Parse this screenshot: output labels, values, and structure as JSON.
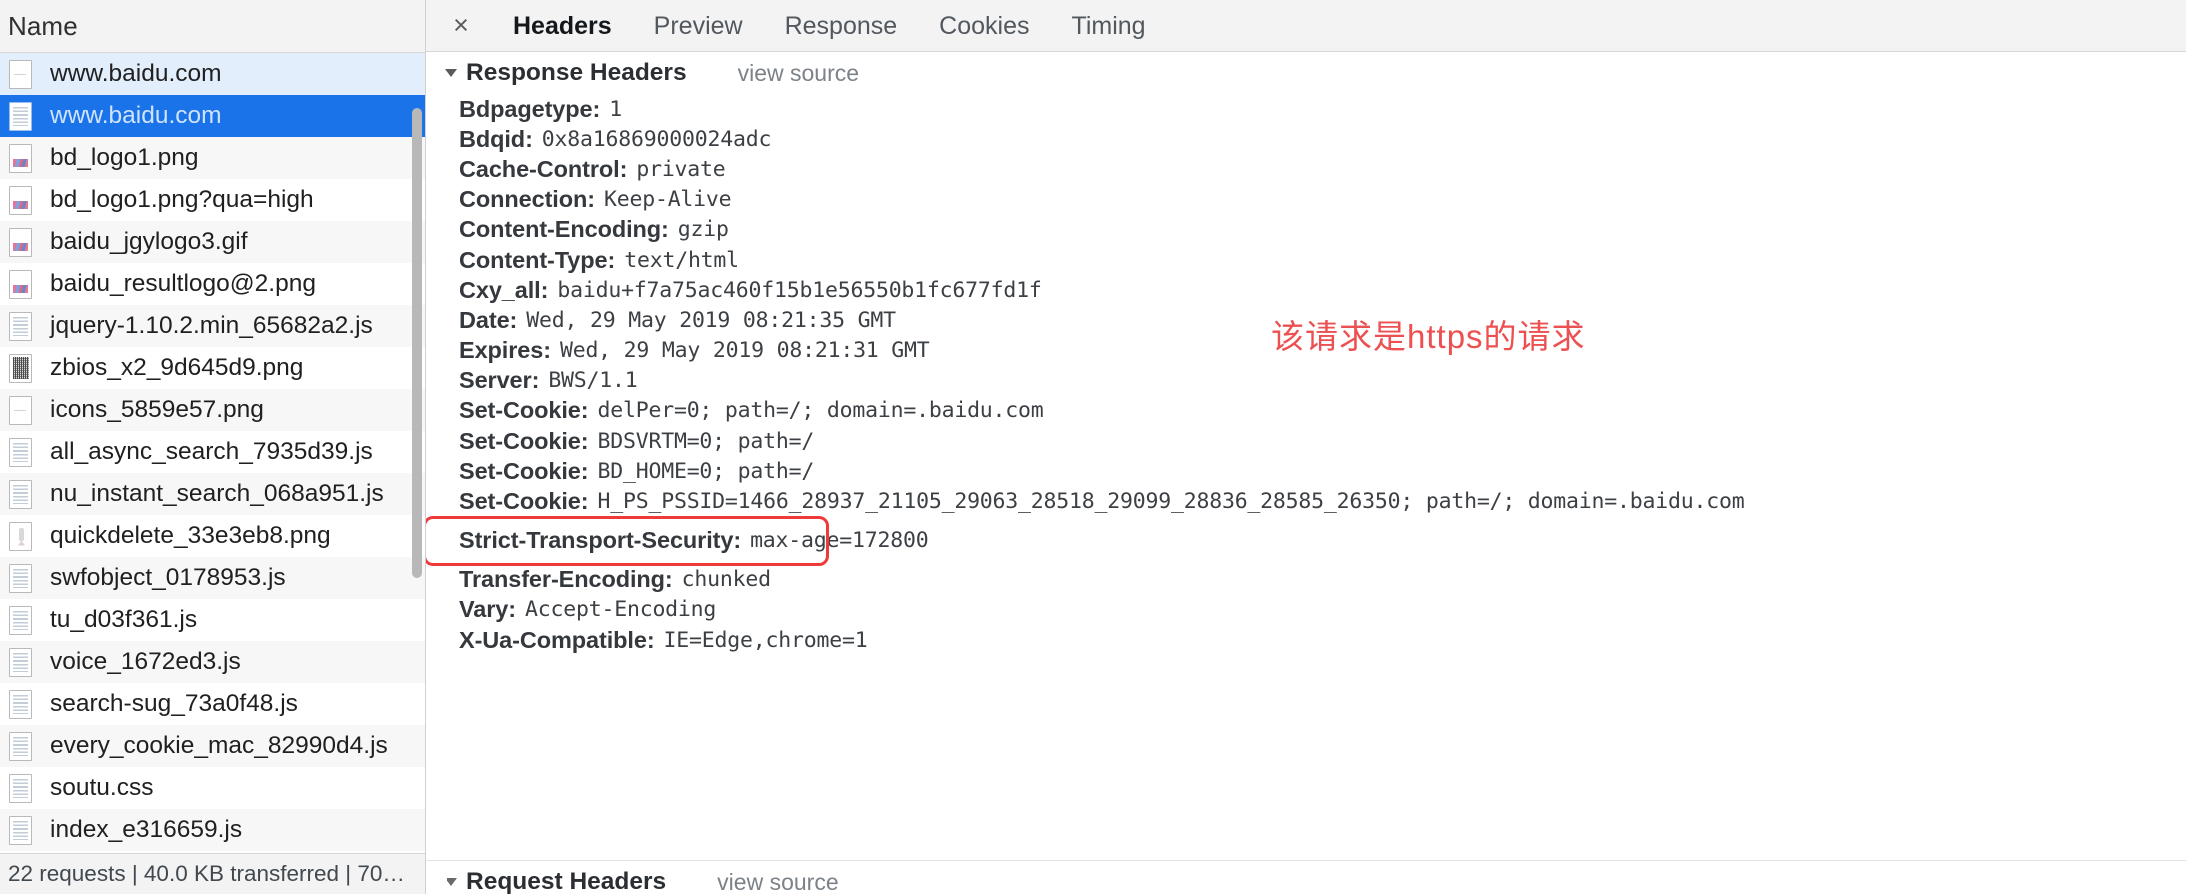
{
  "left_panel": {
    "column_header": "Name",
    "rows": [
      {
        "name": "www.baidu.com",
        "icon": "blank-document-icon",
        "state": "hovered"
      },
      {
        "name": "www.baidu.com",
        "icon": "document-icon",
        "state": "selected"
      },
      {
        "name": "bd_logo1.png",
        "icon": "image-file-icon",
        "state": "zebra"
      },
      {
        "name": "bd_logo1.png?qua=high",
        "icon": "image-file-icon",
        "state": "plain"
      },
      {
        "name": "baidu_jgylogo3.gif",
        "icon": "image-file-icon",
        "state": "zebra"
      },
      {
        "name": "baidu_resultlogo@2.png",
        "icon": "image-file-icon",
        "state": "plain"
      },
      {
        "name": "jquery-1.10.2.min_65682a2.js",
        "icon": "document-icon",
        "state": "zebra"
      },
      {
        "name": "zbios_x2_9d645d9.png",
        "icon": "qr-image-icon",
        "state": "plain"
      },
      {
        "name": "icons_5859e57.png",
        "icon": "blank-document-icon",
        "state": "zebra"
      },
      {
        "name": "all_async_search_7935d39.js",
        "icon": "document-icon",
        "state": "plain"
      },
      {
        "name": "nu_instant_search_068a951.js",
        "icon": "document-icon",
        "state": "zebra"
      },
      {
        "name": "quickdelete_33e3eb8.png",
        "icon": "marker-image-icon",
        "state": "plain"
      },
      {
        "name": "swfobject_0178953.js",
        "icon": "document-icon",
        "state": "zebra"
      },
      {
        "name": "tu_d03f361.js",
        "icon": "document-icon",
        "state": "plain"
      },
      {
        "name": "voice_1672ed3.js",
        "icon": "document-icon",
        "state": "zebra"
      },
      {
        "name": "search-sug_73a0f48.js",
        "icon": "document-icon",
        "state": "plain"
      },
      {
        "name": "every_cookie_mac_82990d4.js",
        "icon": "document-icon",
        "state": "zebra"
      },
      {
        "name": "soutu.css",
        "icon": "document-icon",
        "state": "plain"
      },
      {
        "name": "index_e316659.js",
        "icon": "document-icon",
        "state": "zebra"
      }
    ],
    "status_bar": "22 requests | 40.0 KB transferred | 70…"
  },
  "right_panel": {
    "close_label": "×",
    "tabs": [
      {
        "label": "Headers",
        "active": true
      },
      {
        "label": "Preview",
        "active": false
      },
      {
        "label": "Response",
        "active": false
      },
      {
        "label": "Cookies",
        "active": false
      },
      {
        "label": "Timing",
        "active": false
      }
    ],
    "response_section": {
      "title": "Response Headers",
      "view_source": "view source"
    },
    "request_section": {
      "title": "Request Headers",
      "view_source": "view source"
    },
    "headers": [
      {
        "name": "Bdpagetype:",
        "value": "1"
      },
      {
        "name": "Bdqid:",
        "value": "0x8a16869000024adc"
      },
      {
        "name": "Cache-Control:",
        "value": "private"
      },
      {
        "name": "Connection:",
        "value": "Keep-Alive"
      },
      {
        "name": "Content-Encoding:",
        "value": "gzip"
      },
      {
        "name": "Content-Type:",
        "value": "text/html"
      },
      {
        "name": "Cxy_all:",
        "value": "baidu+f7a75ac460f15b1e56550b1fc677fd1f"
      },
      {
        "name": "Date:",
        "value": "Wed, 29 May 2019 08:21:35 GMT"
      },
      {
        "name": "Expires:",
        "value": "Wed, 29 May 2019 08:21:31 GMT"
      },
      {
        "name": "Server:",
        "value": "BWS/1.1"
      },
      {
        "name": "Set-Cookie:",
        "value": "delPer=0; path=/; domain=.baidu.com"
      },
      {
        "name": "Set-Cookie:",
        "value": "BDSVRTM=0; path=/"
      },
      {
        "name": "Set-Cookie:",
        "value": "BD_HOME=0; path=/"
      },
      {
        "name": "Set-Cookie:",
        "value": "H_PS_PSSID=1466_28937_21105_29063_28518_29099_28836_28585_26350; path=/; domain=.baidu.com"
      },
      {
        "name": "Strict-Transport-Security:",
        "value": "max-age=172800",
        "highlighted": true
      },
      {
        "name": "Transfer-Encoding:",
        "value": "chunked"
      },
      {
        "name": "Vary:",
        "value": "Accept-Encoding"
      },
      {
        "name": "X-Ua-Compatible:",
        "value": "IE=Edge,chrome=1"
      }
    ],
    "annotation": "该请求是https的请求"
  },
  "colors": {
    "selection_blue": "#1a73e8",
    "hover_blue": "#e3eefc",
    "annotation_red": "#ec5050",
    "highlight_box_red": "#ef3a3a",
    "panel_gray": "#f3f3f3",
    "zebra_gray": "#f7f7f7"
  }
}
